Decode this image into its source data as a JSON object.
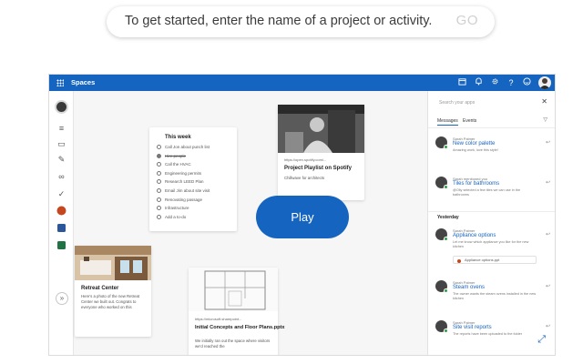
{
  "search": {
    "placeholder": "To get started, enter the name of a project or activity.",
    "go_label": "GO"
  },
  "topbar": {
    "brand": "Spaces",
    "icons": [
      "waffle-icon",
      "calendar-icon",
      "bell-icon",
      "gear-icon",
      "help-icon",
      "smiley-icon"
    ]
  },
  "rail": {
    "icons": [
      "filter-icon",
      "note-icon",
      "pen-icon",
      "link-icon",
      "check-icon",
      "powerpoint-icon",
      "word-icon",
      "excel-icon"
    ],
    "expand_label": "»"
  },
  "task_card": {
    "title": "This week",
    "items": [
      {
        "label": "Call Jon about punch list",
        "done": false
      },
      {
        "label": "Hire people",
        "done": true
      },
      {
        "label": "Call the HVAC",
        "done": false
      },
      {
        "label": "Engineering permits",
        "done": false
      },
      {
        "label": "Research LEED Plan",
        "done": false
      },
      {
        "label": "Email Jim about site visit",
        "done": false
      },
      {
        "label": "Renovating passage",
        "done": false
      },
      {
        "label": "Infrastructure",
        "done": false
      },
      {
        "label": "Add a to-do",
        "done": false
      }
    ]
  },
  "spotify_card": {
    "meta": "https://open.spotify.com/...",
    "title": "Project Playlist on Spotify",
    "desc": "Chillwave for architects"
  },
  "play_button": {
    "label": "Play"
  },
  "retreat_card": {
    "title": "Retreat Center",
    "desc": "Here's a photo of the new Retreat Center we built out. Congrats to everyone who worked on this"
  },
  "concepts_card": {
    "meta": "https://microsoft.sharepoint...",
    "title": "Initial Concepts and Floor Plans.pptx",
    "desc": "We initially ran out the space where visitors we'd reached the"
  },
  "panel": {
    "search_placeholder": "Search your apps",
    "tabs": [
      "Messages",
      "Events"
    ],
    "section_yesterday": "Yesterday",
    "messages": [
      {
        "from": "Sarah Palmer",
        "subject": "New color palette",
        "body": "Amazing work, love this style!"
      },
      {
        "from": "Sarah mentioned you",
        "subject": "Tiles for bathrooms",
        "body": "@Olly selected a few tiles we can use in the bathrooms"
      },
      {
        "from": "Sarah Palmer",
        "subject": "Appliance options",
        "body": "Let me know which appliance you like for the new kitchen",
        "attachment": "Appliance options.ppt"
      },
      {
        "from": "Sarah Palmer",
        "subject": "Steam ovens",
        "body": "The owner wants the steam ovens installed in the new kitchen"
      },
      {
        "from": "Sarah Palmer",
        "subject": "Site visit reports",
        "body": "The reports have been uploaded to the folder"
      }
    ]
  },
  "colors": {
    "accent": "#1565c0",
    "presence": "#2e9e47"
  }
}
